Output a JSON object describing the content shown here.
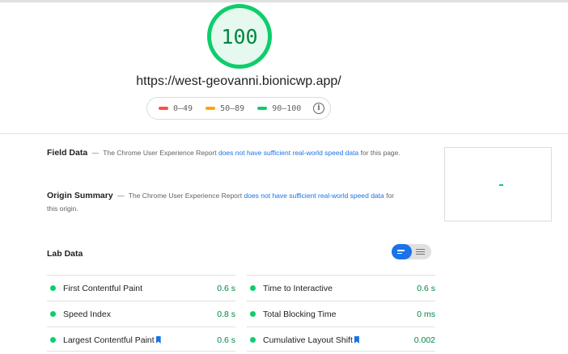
{
  "score": {
    "value": "100",
    "color": "#0cce6b"
  },
  "url": "https://west-geovanni.bionicwp.app/",
  "legend": [
    {
      "label": "0–49",
      "color": "#ff4e42"
    },
    {
      "label": "50–89",
      "color": "#ffa400"
    },
    {
      "label": "90–100",
      "color": "#0cce6b"
    }
  ],
  "field_data": {
    "title": "Field Data",
    "dash": "—",
    "text_before": "The Chrome User Experience Report",
    "link": "does not have sufficient real-world speed data",
    "text_after": "for this page."
  },
  "origin_summary": {
    "title": "Origin Summary",
    "dash": "—",
    "text_before": "The Chrome User Experience Report",
    "link": "does not have sufficient real-world speed data",
    "text_after": "for this origin."
  },
  "lab_data": {
    "title": "Lab Data",
    "metrics": [
      {
        "name": "First Contentful Paint",
        "value": "0.6 s",
        "bookmark": false
      },
      {
        "name": "Time to Interactive",
        "value": "0.6 s",
        "bookmark": false
      },
      {
        "name": "Speed Index",
        "value": "0.8 s",
        "bookmark": false
      },
      {
        "name": "Total Blocking Time",
        "value": "0 ms",
        "bookmark": false
      },
      {
        "name": "Largest Contentful Paint",
        "value": "0.6 s",
        "bookmark": true
      },
      {
        "name": "Cumulative Layout Shift",
        "value": "0.002",
        "bookmark": true
      }
    ]
  },
  "icons": {
    "info": "info-icon",
    "view_toggle_compact": "list-compact-icon",
    "view_toggle_detail": "list-detail-icon",
    "bookmark": "bookmark-icon"
  }
}
